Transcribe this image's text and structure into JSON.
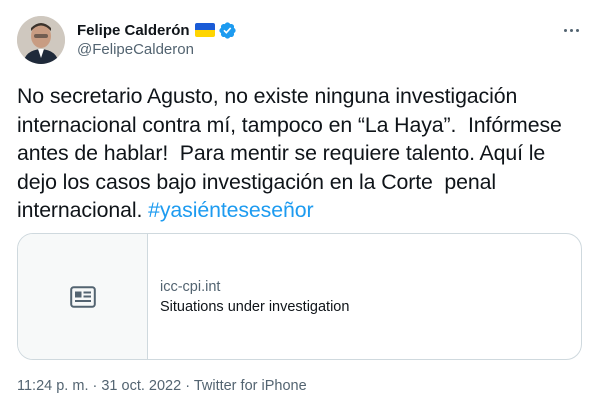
{
  "author": {
    "display_name": "Felipe Calderón",
    "handle": "@FelipeCalderon",
    "flag_icon": "ukraine-flag-icon",
    "verified_icon": "verified-badge-icon",
    "colors": {
      "verified": "#1d9bf0",
      "flag_top": "#1a5bd6",
      "flag_bottom": "#ffd500"
    }
  },
  "tweet": {
    "text": "No secretario Agusto, no existe ninguna investigación internacional contra mí, tampoco en “La Haya”.  Infórmese antes de hablar!  Para mentir se requiere talento. Aquí le dejo los casos bajo investigación en la Corte  penal internacional. ",
    "hashtag": "#yasiénteseseñor"
  },
  "card": {
    "domain": "icc-cpi.int",
    "title": "Situations under investigation",
    "thumb_icon": "article-icon"
  },
  "meta": {
    "time": "11:24 p. m.",
    "separator": " · ",
    "date": "31 oct. 2022",
    "source": "Twitter for iPhone"
  },
  "colors": {
    "text": "#0f1419",
    "secondary": "#536471",
    "link": "#1d9bf0",
    "border": "#cfd9de"
  }
}
